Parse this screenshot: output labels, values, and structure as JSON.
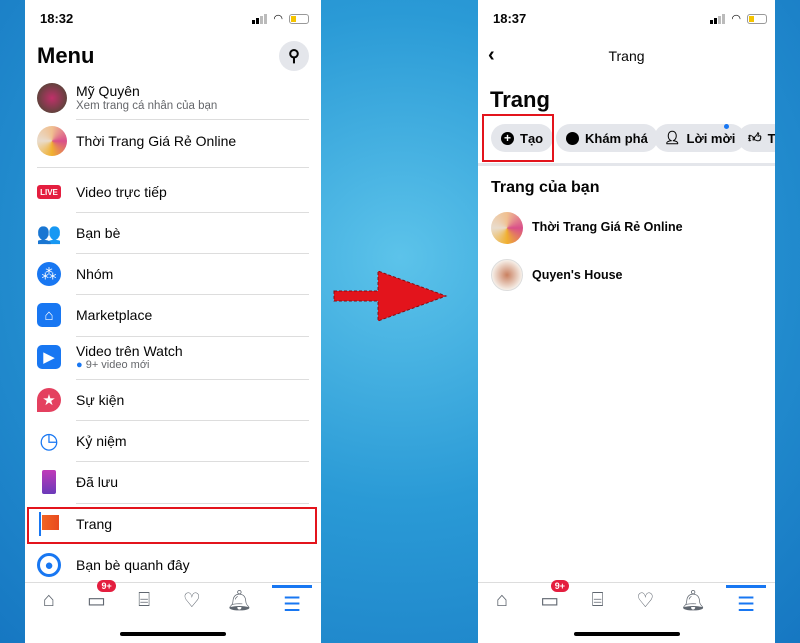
{
  "left_screen": {
    "time": "18:32",
    "title": "Menu",
    "profile": {
      "name": "Mỹ Quyên",
      "subtitle": "Xem trang cá nhân của bạn"
    },
    "page_shortcut": "Thời Trang Giá Rẻ Online",
    "items": [
      {
        "label": "Video trực tiếp",
        "icon": "live-icon",
        "icon_text": "LIVE",
        "color": "#e41e3f"
      },
      {
        "label": "Bạn bè",
        "icon": "friends-icon",
        "color": "#1877f2"
      },
      {
        "label": "Nhóm",
        "icon": "groups-icon",
        "color": "#1877f2"
      },
      {
        "label": "Marketplace",
        "icon": "marketplace-icon",
        "color": "#1877f2"
      },
      {
        "label": "Video trên Watch",
        "sub": "9+ video mới",
        "icon": "watch-icon",
        "color": "#1877f2"
      },
      {
        "label": "Sự kiện",
        "icon": "events-icon",
        "color": "#e4405f"
      },
      {
        "label": "Kỷ niệm",
        "icon": "memories-icon",
        "color": "#1877f2"
      },
      {
        "label": "Đã lưu",
        "icon": "saved-icon",
        "color": "#8a3ab9"
      },
      {
        "label": "Trang",
        "icon": "pages-flag-icon",
        "color": "#f26522"
      },
      {
        "label": "Bạn bè quanh đây",
        "icon": "nearby-friends-icon",
        "color": "#1877f2"
      }
    ],
    "highlighted": "Trang"
  },
  "right_screen": {
    "time": "18:37",
    "header": "Trang",
    "title": "Trang",
    "chips": [
      {
        "label": "Tạo",
        "icon": "plus-circle-icon"
      },
      {
        "label": "Khám phá",
        "icon": "discover-icon"
      },
      {
        "label": "Lời mời",
        "icon": "invite-icon"
      },
      {
        "label": "Tr",
        "icon": "like-icon"
      }
    ],
    "highlighted": "Tạo",
    "section": "Trang của bạn",
    "pages": [
      "Thời Trang Giá Rẻ Online",
      "Quyen's House"
    ]
  },
  "nav": {
    "badge": "9+",
    "active": "menu"
  },
  "colors": {
    "accent": "#1877f2",
    "highlight": "#e3141c",
    "arrow": "#e3141c"
  }
}
